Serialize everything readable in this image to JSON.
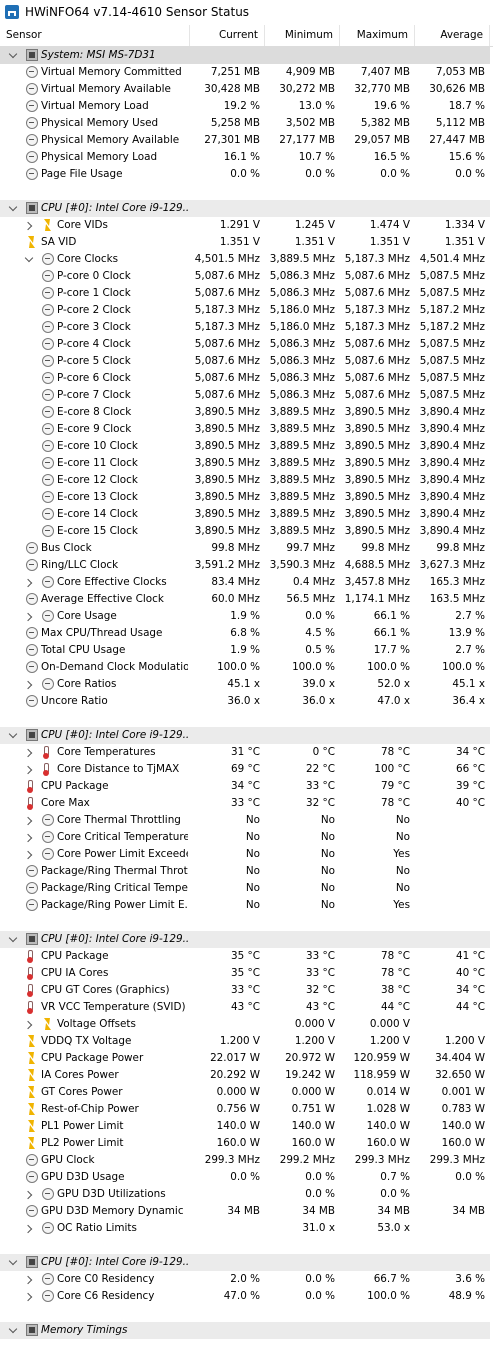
{
  "window": {
    "title": "HWiNFO64 v7.14-4610 Sensor Status"
  },
  "columns": [
    "Sensor",
    "Current",
    "Minimum",
    "Maximum",
    "Average"
  ],
  "rows": [
    {
      "type": "group",
      "level": 0,
      "icon": "chip",
      "chev": "down",
      "label": "System: MSI MS-7D31",
      "v": [
        "",
        "",
        "",
        ""
      ]
    },
    {
      "level": 1,
      "icon": "clock",
      "label": "Virtual Memory Committed",
      "v": [
        "7,251 MB",
        "4,909 MB",
        "7,407 MB",
        "7,053 MB"
      ]
    },
    {
      "level": 1,
      "icon": "clock",
      "label": "Virtual Memory Available",
      "v": [
        "30,428 MB",
        "30,272 MB",
        "32,770 MB",
        "30,626 MB"
      ]
    },
    {
      "level": 1,
      "icon": "clock",
      "label": "Virtual Memory Load",
      "v": [
        "19.2 %",
        "13.0 %",
        "19.6 %",
        "18.7 %"
      ]
    },
    {
      "level": 1,
      "icon": "clock",
      "label": "Physical Memory Used",
      "v": [
        "5,258 MB",
        "3,502 MB",
        "5,382 MB",
        "5,112 MB"
      ]
    },
    {
      "level": 1,
      "icon": "clock",
      "label": "Physical Memory Available",
      "v": [
        "27,301 MB",
        "27,177 MB",
        "29,057 MB",
        "27,447 MB"
      ]
    },
    {
      "level": 1,
      "icon": "clock",
      "label": "Physical Memory Load",
      "v": [
        "16.1 %",
        "10.7 %",
        "16.5 %",
        "15.6 %"
      ]
    },
    {
      "level": 1,
      "icon": "clock",
      "label": "Page File Usage",
      "v": [
        "0.0 %",
        "0.0 %",
        "0.0 %",
        "0.0 %"
      ]
    },
    {
      "type": "blank"
    },
    {
      "type": "group",
      "level": 0,
      "icon": "chip",
      "chev": "down",
      "label": "CPU [#0]: Intel Core i9-129...",
      "v": [
        "",
        "",
        "",
        ""
      ]
    },
    {
      "level": 1,
      "icon": "bolt",
      "chev": "right",
      "label": "Core VIDs",
      "v": [
        "1.291 V",
        "1.245 V",
        "1.474 V",
        "1.334 V"
      ]
    },
    {
      "level": 1,
      "icon": "bolt",
      "label": "SA VID",
      "v": [
        "1.351 V",
        "1.351 V",
        "1.351 V",
        "1.351 V"
      ]
    },
    {
      "level": 1,
      "icon": "clock",
      "chev": "down",
      "label": "Core Clocks",
      "v": [
        "4,501.5 MHz",
        "3,889.5 MHz",
        "5,187.3 MHz",
        "4,501.4 MHz"
      ]
    },
    {
      "level": 2,
      "icon": "clock",
      "label": "P-core 0 Clock",
      "v": [
        "5,087.6 MHz",
        "5,086.3 MHz",
        "5,087.6 MHz",
        "5,087.5 MHz"
      ]
    },
    {
      "level": 2,
      "icon": "clock",
      "label": "P-core 1 Clock",
      "v": [
        "5,087.6 MHz",
        "5,086.3 MHz",
        "5,087.6 MHz",
        "5,087.5 MHz"
      ]
    },
    {
      "level": 2,
      "icon": "clock",
      "label": "P-core 2 Clock",
      "v": [
        "5,187.3 MHz",
        "5,186.0 MHz",
        "5,187.3 MHz",
        "5,187.2 MHz"
      ]
    },
    {
      "level": 2,
      "icon": "clock",
      "label": "P-core 3 Clock",
      "v": [
        "5,187.3 MHz",
        "5,186.0 MHz",
        "5,187.3 MHz",
        "5,187.2 MHz"
      ]
    },
    {
      "level": 2,
      "icon": "clock",
      "label": "P-core 4 Clock",
      "v": [
        "5,087.6 MHz",
        "5,086.3 MHz",
        "5,087.6 MHz",
        "5,087.5 MHz"
      ]
    },
    {
      "level": 2,
      "icon": "clock",
      "label": "P-core 5 Clock",
      "v": [
        "5,087.6 MHz",
        "5,086.3 MHz",
        "5,087.6 MHz",
        "5,087.5 MHz"
      ]
    },
    {
      "level": 2,
      "icon": "clock",
      "label": "P-core 6 Clock",
      "v": [
        "5,087.6 MHz",
        "5,086.3 MHz",
        "5,087.6 MHz",
        "5,087.5 MHz"
      ]
    },
    {
      "level": 2,
      "icon": "clock",
      "label": "P-core 7 Clock",
      "v": [
        "5,087.6 MHz",
        "5,086.3 MHz",
        "5,087.6 MHz",
        "5,087.5 MHz"
      ]
    },
    {
      "level": 2,
      "icon": "clock",
      "label": "E-core 8 Clock",
      "v": [
        "3,890.5 MHz",
        "3,889.5 MHz",
        "3,890.5 MHz",
        "3,890.4 MHz"
      ]
    },
    {
      "level": 2,
      "icon": "clock",
      "label": "E-core 9 Clock",
      "v": [
        "3,890.5 MHz",
        "3,889.5 MHz",
        "3,890.5 MHz",
        "3,890.4 MHz"
      ]
    },
    {
      "level": 2,
      "icon": "clock",
      "label": "E-core 10 Clock",
      "v": [
        "3,890.5 MHz",
        "3,889.5 MHz",
        "3,890.5 MHz",
        "3,890.4 MHz"
      ]
    },
    {
      "level": 2,
      "icon": "clock",
      "label": "E-core 11 Clock",
      "v": [
        "3,890.5 MHz",
        "3,889.5 MHz",
        "3,890.5 MHz",
        "3,890.4 MHz"
      ]
    },
    {
      "level": 2,
      "icon": "clock",
      "label": "E-core 12 Clock",
      "v": [
        "3,890.5 MHz",
        "3,889.5 MHz",
        "3,890.5 MHz",
        "3,890.4 MHz"
      ]
    },
    {
      "level": 2,
      "icon": "clock",
      "label": "E-core 13 Clock",
      "v": [
        "3,890.5 MHz",
        "3,889.5 MHz",
        "3,890.5 MHz",
        "3,890.4 MHz"
      ]
    },
    {
      "level": 2,
      "icon": "clock",
      "label": "E-core 14 Clock",
      "v": [
        "3,890.5 MHz",
        "3,889.5 MHz",
        "3,890.5 MHz",
        "3,890.4 MHz"
      ]
    },
    {
      "level": 2,
      "icon": "clock",
      "label": "E-core 15 Clock",
      "v": [
        "3,890.5 MHz",
        "3,889.5 MHz",
        "3,890.5 MHz",
        "3,890.4 MHz"
      ]
    },
    {
      "level": 1,
      "icon": "clock",
      "label": "Bus Clock",
      "v": [
        "99.8 MHz",
        "99.7 MHz",
        "99.8 MHz",
        "99.8 MHz"
      ]
    },
    {
      "level": 1,
      "icon": "clock",
      "label": "Ring/LLC Clock",
      "v": [
        "3,591.2 MHz",
        "3,590.3 MHz",
        "4,688.5 MHz",
        "3,627.3 MHz"
      ]
    },
    {
      "level": 1,
      "icon": "clock",
      "chev": "right",
      "label": "Core Effective Clocks",
      "v": [
        "83.4 MHz",
        "0.4 MHz",
        "3,457.8 MHz",
        "165.3 MHz"
      ]
    },
    {
      "level": 1,
      "icon": "clock",
      "label": "Average Effective Clock",
      "v": [
        "60.0 MHz",
        "56.5 MHz",
        "1,174.1 MHz",
        "163.5 MHz"
      ]
    },
    {
      "level": 1,
      "icon": "clock",
      "chev": "right",
      "label": "Core Usage",
      "v": [
        "1.9 %",
        "0.0 %",
        "66.1 %",
        "2.7 %"
      ]
    },
    {
      "level": 1,
      "icon": "clock",
      "label": "Max CPU/Thread Usage",
      "v": [
        "6.8 %",
        "4.5 %",
        "66.1 %",
        "13.9 %"
      ]
    },
    {
      "level": 1,
      "icon": "clock",
      "label": "Total CPU Usage",
      "v": [
        "1.9 %",
        "0.5 %",
        "17.7 %",
        "2.7 %"
      ]
    },
    {
      "level": 1,
      "icon": "clock",
      "label": "On-Demand Clock Modulation",
      "v": [
        "100.0 %",
        "100.0 %",
        "100.0 %",
        "100.0 %"
      ]
    },
    {
      "level": 1,
      "icon": "clock",
      "chev": "right",
      "label": "Core Ratios",
      "v": [
        "45.1 x",
        "39.0 x",
        "52.0 x",
        "45.1 x"
      ]
    },
    {
      "level": 1,
      "icon": "clock",
      "label": "Uncore Ratio",
      "v": [
        "36.0 x",
        "36.0 x",
        "47.0 x",
        "36.4 x"
      ]
    },
    {
      "type": "blank"
    },
    {
      "type": "group",
      "level": 0,
      "icon": "chip",
      "chev": "down",
      "label": "CPU [#0]: Intel Core i9-129...",
      "v": [
        "",
        "",
        "",
        ""
      ]
    },
    {
      "level": 1,
      "icon": "therm",
      "chev": "right",
      "label": "Core Temperatures",
      "v": [
        "31 °C",
        "0 °C",
        "78 °C",
        "34 °C"
      ]
    },
    {
      "level": 1,
      "icon": "therm",
      "chev": "right",
      "label": "Core Distance to TjMAX",
      "v": [
        "69 °C",
        "22 °C",
        "100 °C",
        "66 °C"
      ]
    },
    {
      "level": 1,
      "icon": "therm",
      "label": "CPU Package",
      "v": [
        "34 °C",
        "33 °C",
        "79 °C",
        "39 °C"
      ]
    },
    {
      "level": 1,
      "icon": "therm",
      "label": "Core Max",
      "v": [
        "33 °C",
        "32 °C",
        "78 °C",
        "40 °C"
      ]
    },
    {
      "level": 1,
      "icon": "clock",
      "chev": "right",
      "label": "Core Thermal Throttling",
      "v": [
        "No",
        "No",
        "No",
        ""
      ]
    },
    {
      "level": 1,
      "icon": "clock",
      "chev": "right",
      "label": "Core Critical Temperature",
      "v": [
        "No",
        "No",
        "No",
        ""
      ]
    },
    {
      "level": 1,
      "icon": "clock",
      "chev": "right",
      "label": "Core Power Limit Exceeded",
      "v": [
        "No",
        "No",
        "Yes",
        ""
      ]
    },
    {
      "level": 1,
      "icon": "clock",
      "label": "Package/Ring Thermal Throt...",
      "v": [
        "No",
        "No",
        "No",
        ""
      ]
    },
    {
      "level": 1,
      "icon": "clock",
      "label": "Package/Ring Critical Tempe...",
      "v": [
        "No",
        "No",
        "No",
        ""
      ]
    },
    {
      "level": 1,
      "icon": "clock",
      "label": "Package/Ring Power Limit E...",
      "v": [
        "No",
        "No",
        "Yes",
        ""
      ]
    },
    {
      "type": "blank"
    },
    {
      "type": "group",
      "level": 0,
      "icon": "chip",
      "chev": "down",
      "label": "CPU [#0]: Intel Core i9-129...",
      "v": [
        "",
        "",
        "",
        ""
      ]
    },
    {
      "level": 1,
      "icon": "therm",
      "label": "CPU Package",
      "v": [
        "35 °C",
        "33 °C",
        "78 °C",
        "41 °C"
      ]
    },
    {
      "level": 1,
      "icon": "therm",
      "label": "CPU IA Cores",
      "v": [
        "35 °C",
        "33 °C",
        "78 °C",
        "40 °C"
      ]
    },
    {
      "level": 1,
      "icon": "therm",
      "label": "CPU GT Cores (Graphics)",
      "v": [
        "33 °C",
        "32 °C",
        "38 °C",
        "34 °C"
      ]
    },
    {
      "level": 1,
      "icon": "therm",
      "label": "VR VCC Temperature (SVID)",
      "v": [
        "43 °C",
        "43 °C",
        "44 °C",
        "44 °C"
      ]
    },
    {
      "level": 1,
      "icon": "bolt",
      "chev": "right",
      "label": "Voltage Offsets",
      "v": [
        "",
        "0.000 V",
        "0.000 V",
        ""
      ]
    },
    {
      "level": 1,
      "icon": "bolt",
      "label": "VDDQ TX Voltage",
      "v": [
        "1.200 V",
        "1.200 V",
        "1.200 V",
        "1.200 V"
      ]
    },
    {
      "level": 1,
      "icon": "bolt",
      "label": "CPU Package Power",
      "v": [
        "22.017 W",
        "20.972 W",
        "120.959 W",
        "34.404 W"
      ]
    },
    {
      "level": 1,
      "icon": "bolt",
      "label": "IA Cores Power",
      "v": [
        "20.292 W",
        "19.242 W",
        "118.959 W",
        "32.650 W"
      ]
    },
    {
      "level": 1,
      "icon": "bolt",
      "label": "GT Cores Power",
      "v": [
        "0.000 W",
        "0.000 W",
        "0.014 W",
        "0.001 W"
      ]
    },
    {
      "level": 1,
      "icon": "bolt",
      "label": "Rest-of-Chip Power",
      "v": [
        "0.756 W",
        "0.751 W",
        "1.028 W",
        "0.783 W"
      ]
    },
    {
      "level": 1,
      "icon": "bolt",
      "label": "PL1 Power Limit",
      "v": [
        "140.0 W",
        "140.0 W",
        "140.0 W",
        "140.0 W"
      ]
    },
    {
      "level": 1,
      "icon": "bolt",
      "label": "PL2 Power Limit",
      "v": [
        "160.0 W",
        "160.0 W",
        "160.0 W",
        "160.0 W"
      ]
    },
    {
      "level": 1,
      "icon": "clock",
      "label": "GPU Clock",
      "v": [
        "299.3 MHz",
        "299.2 MHz",
        "299.3 MHz",
        "299.3 MHz"
      ]
    },
    {
      "level": 1,
      "icon": "clock",
      "label": "GPU D3D Usage",
      "v": [
        "0.0 %",
        "0.0 %",
        "0.7 %",
        "0.0 %"
      ]
    },
    {
      "level": 1,
      "icon": "clock",
      "chev": "right",
      "label": "GPU D3D Utilizations",
      "v": [
        "",
        "0.0 %",
        "0.0 %",
        ""
      ]
    },
    {
      "level": 1,
      "icon": "clock",
      "label": "GPU D3D Memory Dynamic",
      "v": [
        "34 MB",
        "34 MB",
        "34 MB",
        "34 MB"
      ]
    },
    {
      "level": 1,
      "icon": "clock",
      "chev": "right",
      "label": "OC Ratio Limits",
      "v": [
        "",
        "31.0 x",
        "53.0 x",
        ""
      ]
    },
    {
      "type": "blank"
    },
    {
      "type": "group",
      "level": 0,
      "icon": "chip",
      "chev": "down",
      "label": "CPU [#0]: Intel Core i9-129...",
      "v": [
        "",
        "",
        "",
        ""
      ]
    },
    {
      "level": 1,
      "icon": "clock",
      "chev": "right",
      "label": "Core C0 Residency",
      "v": [
        "2.0 %",
        "0.0 %",
        "66.7 %",
        "3.6 %"
      ]
    },
    {
      "level": 1,
      "icon": "clock",
      "chev": "right",
      "label": "Core C6 Residency",
      "v": [
        "47.0 %",
        "0.0 %",
        "100.0 %",
        "48.9 %"
      ]
    },
    {
      "type": "blank"
    },
    {
      "type": "group",
      "level": 0,
      "icon": "chip",
      "chev": "down",
      "label": "Memory Timings",
      "v": [
        "",
        "",
        "",
        ""
      ]
    }
  ]
}
